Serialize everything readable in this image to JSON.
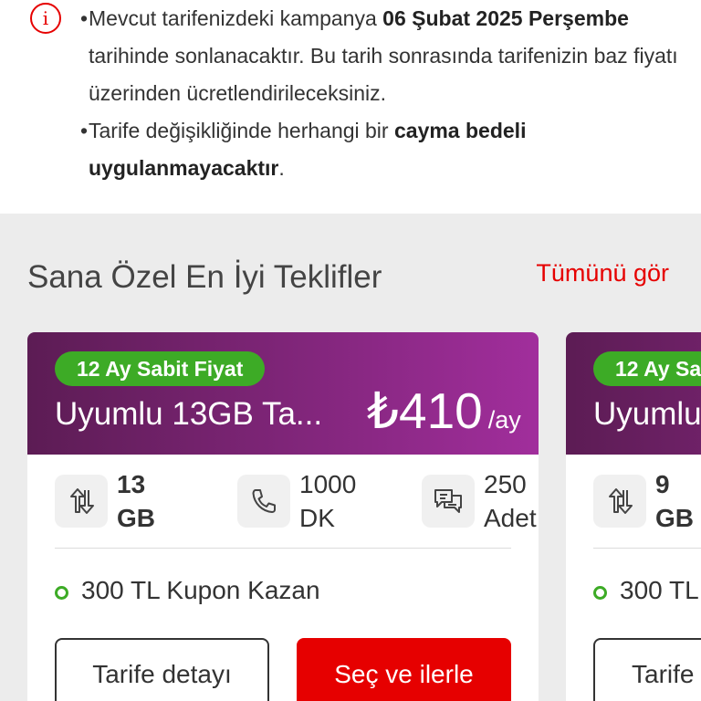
{
  "notice": {
    "icon": "info-circle-icon",
    "bullet1": {
      "part1": "Mevcut tarifenizdeki kampanya ",
      "bold": "06 Şubat 2025 Perşembe",
      "part2": " tarihinde sonlanacaktır. Bu tarih sonrasında tarifenizin baz fiyatı üzerinden ücretlendirileceksiniz."
    },
    "bullet2": {
      "part1": "Tarife değişikliğinde herhangi bir ",
      "bold": "cayma bedeli uygulanmayacaktır",
      "part2": "."
    }
  },
  "offers": {
    "title": "Sana Özel En İyi Teklifler",
    "see_all": "Tümünü gör",
    "cards": [
      {
        "tag": "12 Ay Sabit Fiyat",
        "name": "Uyumlu 13GB Ta...",
        "price": "₺410",
        "period": "/ay",
        "data_value": "13",
        "data_unit": "GB",
        "minutes_value": "1000",
        "minutes_unit": "DK",
        "sms_value": "250",
        "sms_unit": "Adet",
        "benefit": "300 TL Kupon Kazan",
        "detail_label": "Tarife detayı",
        "select_label": "Seç ve ilerle"
      },
      {
        "tag": "12 Ay Sa",
        "name": "Uyumlu",
        "data_value": "9",
        "data_unit": "GB",
        "benefit": "300 TL",
        "detail_label": "Tarife"
      }
    ]
  },
  "icons": {
    "data": "data-transfer-icon",
    "minutes": "phone-icon",
    "sms": "message-icon"
  },
  "colors": {
    "brand_red": "#e60000",
    "tag_green": "#3dab26",
    "card_gradient_start": "#5c1c54",
    "card_gradient_end": "#a12e9c"
  }
}
